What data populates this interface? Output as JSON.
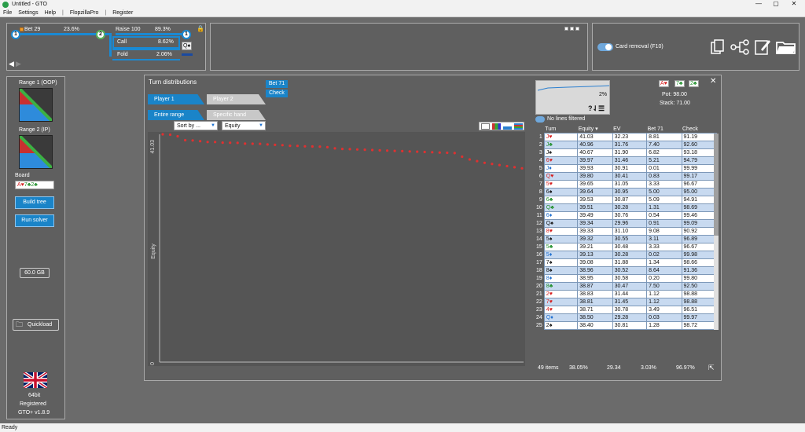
{
  "window": {
    "title": "Untitled - GTO",
    "min": "—",
    "max": "▢",
    "close": "✕"
  },
  "menu": [
    "File",
    "Settings",
    "Help",
    "|",
    "FlopzillaPro",
    "|",
    "Register"
  ],
  "status": "Ready",
  "tree": {
    "node1": "1",
    "node2": "2",
    "node3": "1",
    "bet_label": "Bet 29",
    "bet_pct": "23.6%",
    "raise_label": "Raise 100",
    "raise_pct": "89.3%",
    "call_label": "Call",
    "call_pct": "8.62%",
    "fold_label": "Fold",
    "fold_pct": "2.06%",
    "card": "Q♠"
  },
  "right_panel": {
    "card_removal": "Card removal (F10)"
  },
  "left": {
    "range1": "Range 1 (OOP)",
    "range2": "Range 2 (IP)",
    "board_label": "Board",
    "board_cards": [
      {
        "r": "A",
        "s": "♥",
        "c": "red"
      },
      {
        "r": "7",
        "s": "♣",
        "c": "green"
      },
      {
        "r": "2",
        "s": "♣",
        "c": "green"
      }
    ],
    "build_tree": "Build tree",
    "run_solver": "Run solver",
    "memory": "60.0 GB",
    "quickload": "Quickload",
    "bits": "64bit",
    "registered": "Registered",
    "version": "GTO+ v1.8.9"
  },
  "main": {
    "title": "Turn distributions",
    "bet_btn": "Bet 71",
    "check_btn": "Check",
    "player1": "Player 1",
    "player2": "Player 2",
    "entire": "Entire range",
    "specific": "Specific hand",
    "sort": "Sort by ...",
    "metric": "Equity",
    "mini_pct": "2%",
    "no_lines": "No lines filtered",
    "board_cards": [
      {
        "r": "A",
        "s": "♥",
        "c": "red"
      },
      {
        "r": "7",
        "s": "♣",
        "c": "green"
      },
      {
        "r": "2",
        "s": "♣",
        "c": "green"
      }
    ],
    "pot": "Pot: 98.00",
    "stack": "Stack: 71.00",
    "footer": {
      "items": "49 items",
      "eq": "38.05%",
      "ev": "29.34",
      "bet": "3.03%",
      "check": "96.97%"
    }
  },
  "chart_data": {
    "type": "scatter",
    "ylabel": "Equity",
    "ylim": [
      0,
      41.03
    ],
    "yticks": [
      "41.03",
      "0"
    ],
    "series": [
      {
        "values": [
          41.03,
          40.96,
          40.67,
          39.97,
          39.93,
          39.8,
          39.65,
          39.64,
          39.53,
          39.51,
          39.49,
          39.34,
          39.33,
          39.32,
          39.21,
          39.13,
          39.08,
          38.96,
          38.95,
          38.87,
          38.83,
          38.81,
          38.71,
          38.5,
          38.4,
          38.35,
          38.3,
          38.25,
          38.2,
          38.15,
          38.1,
          38.05,
          38.0,
          37.95,
          37.9,
          37.85,
          37.8,
          37.75,
          37.7,
          37.65,
          37.0,
          36.5,
          36.2,
          35.9,
          35.7,
          35.5,
          35.3,
          35.1,
          34.9
        ]
      }
    ],
    "color": "#e03030"
  },
  "table": {
    "headers": [
      "Turn",
      "Equity ▾",
      "EV",
      "Bet 71",
      "Check"
    ],
    "rows": [
      {
        "i": "1",
        "r": "J",
        "s": "♥",
        "c": "red",
        "eq": "41.03",
        "ev": "32.23",
        "bet": "8.81",
        "chk": "91.19"
      },
      {
        "i": "2",
        "r": "J",
        "s": "♣",
        "c": "green",
        "eq": "40.96",
        "ev": "31.76",
        "bet": "7.40",
        "chk": "92.60"
      },
      {
        "i": "3",
        "r": "J",
        "s": "♠",
        "c": "black",
        "eq": "40.67",
        "ev": "31.90",
        "bet": "6.82",
        "chk": "93.18"
      },
      {
        "i": "4",
        "r": "6",
        "s": "♥",
        "c": "red",
        "eq": "39.97",
        "ev": "31.46",
        "bet": "5.21",
        "chk": "94.79"
      },
      {
        "i": "5",
        "r": "J",
        "s": "♦",
        "c": "blue",
        "eq": "39.93",
        "ev": "30.91",
        "bet": "0.01",
        "chk": "99.99"
      },
      {
        "i": "6",
        "r": "Q",
        "s": "♥",
        "c": "red",
        "eq": "39.80",
        "ev": "30.41",
        "bet": "0.83",
        "chk": "99.17"
      },
      {
        "i": "7",
        "r": "5",
        "s": "♥",
        "c": "red",
        "eq": "39.65",
        "ev": "31.05",
        "bet": "3.33",
        "chk": "96.67"
      },
      {
        "i": "8",
        "r": "6",
        "s": "♠",
        "c": "black",
        "eq": "39.64",
        "ev": "30.95",
        "bet": "5.00",
        "chk": "95.00"
      },
      {
        "i": "9",
        "r": "6",
        "s": "♣",
        "c": "green",
        "eq": "39.53",
        "ev": "30.87",
        "bet": "5.09",
        "chk": "94.91"
      },
      {
        "i": "10",
        "r": "Q",
        "s": "♣",
        "c": "green",
        "eq": "39.51",
        "ev": "30.28",
        "bet": "1.31",
        "chk": "98.69"
      },
      {
        "i": "11",
        "r": "6",
        "s": "♦",
        "c": "blue",
        "eq": "39.49",
        "ev": "30.76",
        "bet": "0.54",
        "chk": "99.46"
      },
      {
        "i": "12",
        "r": "Q",
        "s": "♠",
        "c": "black",
        "eq": "39.34",
        "ev": "29.96",
        "bet": "0.91",
        "chk": "99.09"
      },
      {
        "i": "13",
        "r": "8",
        "s": "♥",
        "c": "red",
        "eq": "39.33",
        "ev": "31.10",
        "bet": "9.08",
        "chk": "90.92"
      },
      {
        "i": "14",
        "r": "5",
        "s": "♠",
        "c": "black",
        "eq": "39.32",
        "ev": "30.55",
        "bet": "3.11",
        "chk": "96.89"
      },
      {
        "i": "15",
        "r": "5",
        "s": "♣",
        "c": "green",
        "eq": "39.21",
        "ev": "30.48",
        "bet": "3.33",
        "chk": "96.67"
      },
      {
        "i": "16",
        "r": "5",
        "s": "♦",
        "c": "blue",
        "eq": "39.13",
        "ev": "30.28",
        "bet": "0.02",
        "chk": "99.98"
      },
      {
        "i": "17",
        "r": "7",
        "s": "♠",
        "c": "black",
        "eq": "39.08",
        "ev": "31.88",
        "bet": "1.34",
        "chk": "98.66"
      },
      {
        "i": "18",
        "r": "8",
        "s": "♠",
        "c": "black",
        "eq": "38.96",
        "ev": "30.52",
        "bet": "8.64",
        "chk": "91.36"
      },
      {
        "i": "19",
        "r": "8",
        "s": "♦",
        "c": "blue",
        "eq": "38.95",
        "ev": "30.58",
        "bet": "0.20",
        "chk": "99.80"
      },
      {
        "i": "20",
        "r": "8",
        "s": "♣",
        "c": "green",
        "eq": "38.87",
        "ev": "30.47",
        "bet": "7.50",
        "chk": "92.50"
      },
      {
        "i": "21",
        "r": "2",
        "s": "♥",
        "c": "red",
        "eq": "38.83",
        "ev": "31.44",
        "bet": "1.12",
        "chk": "98.88"
      },
      {
        "i": "22",
        "r": "7",
        "s": "♥",
        "c": "red",
        "eq": "38.81",
        "ev": "31.45",
        "bet": "1.12",
        "chk": "98.88"
      },
      {
        "i": "23",
        "r": "4",
        "s": "♥",
        "c": "red",
        "eq": "38.71",
        "ev": "30.78",
        "bet": "3.49",
        "chk": "96.51"
      },
      {
        "i": "24",
        "r": "Q",
        "s": "♦",
        "c": "blue",
        "eq": "38.50",
        "ev": "29.28",
        "bet": "0.03",
        "chk": "99.97"
      },
      {
        "i": "25",
        "r": "2",
        "s": "♠",
        "c": "black",
        "eq": "38.40",
        "ev": "30.81",
        "bet": "1.28",
        "chk": "98.72"
      }
    ]
  }
}
